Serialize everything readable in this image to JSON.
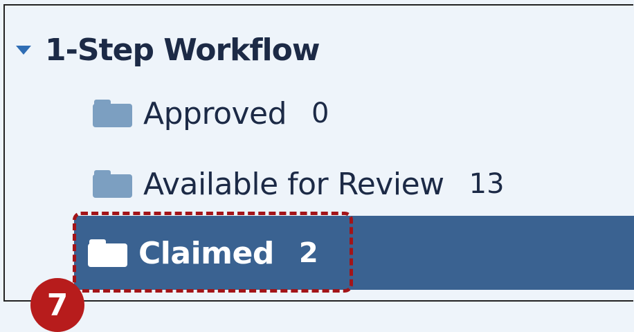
{
  "tree": {
    "group": {
      "label": "1-Step Workflow"
    },
    "folders": [
      {
        "name": "Approved",
        "count": "0"
      },
      {
        "name": "Available for Review",
        "count": "13"
      },
      {
        "name": "Claimed",
        "count": "2",
        "selected": true
      }
    ]
  },
  "callout": {
    "number": "7",
    "color": "#b71c1c"
  },
  "colors": {
    "selected_bg": "#3a6291",
    "folder_icon": "#7c9fc1",
    "expand_arrow": "#2f6db4",
    "text": "#1c2a46"
  }
}
